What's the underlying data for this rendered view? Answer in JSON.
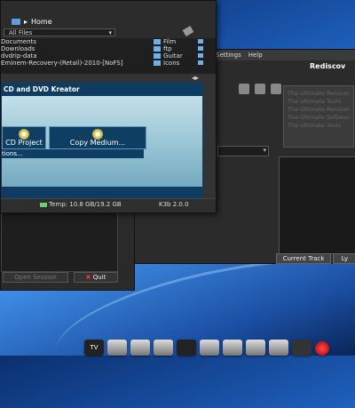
{
  "file_panel": {
    "breadcrumb": "Home",
    "filter": "All Files",
    "files_left": [
      "Documents",
      "Downloads",
      "dvdrip-data",
      "Eminem-Recovery-(Retail)-2010-[NoFS]"
    ],
    "files_right": [
      "Film",
      "ftp",
      "Guitar",
      "Icons"
    ]
  },
  "project": {
    "title": "CD and DVD Kreator",
    "buttons": [
      "CD Project",
      "Copy Medium..."
    ],
    "more_label": "tions..."
  },
  "status": {
    "temp": "Temp: 10.8 GB/19.2 GB",
    "version": "K3b 2.0.0"
  },
  "media": {
    "menu": [
      "Settings",
      "Help"
    ],
    "title": "Rediscov",
    "info_lines": [
      "The Ultimate Recovery Time",
      "The Ultimate Tools",
      "The Ultimate Recovery",
      "The Ultimate Software",
      "The Ultimate Tools"
    ],
    "current_track_label": "Current Track",
    "ly_label": "Ly"
  },
  "bg_window": {
    "buttons": [
      "Open Session",
      "Quit"
    ]
  },
  "dock": {
    "tv_label": "TV",
    "icons": [
      "tv-icon",
      "media-icon",
      "image-icon",
      "photo-icon",
      "diamond-icon",
      "monitor-icon",
      "terminal-icon",
      "tools-icon",
      "drive-icon",
      "display-icon",
      "red-icon"
    ]
  },
  "colors": {
    "project_header": "#0e3b62",
    "desktop": "#1d5db8"
  }
}
